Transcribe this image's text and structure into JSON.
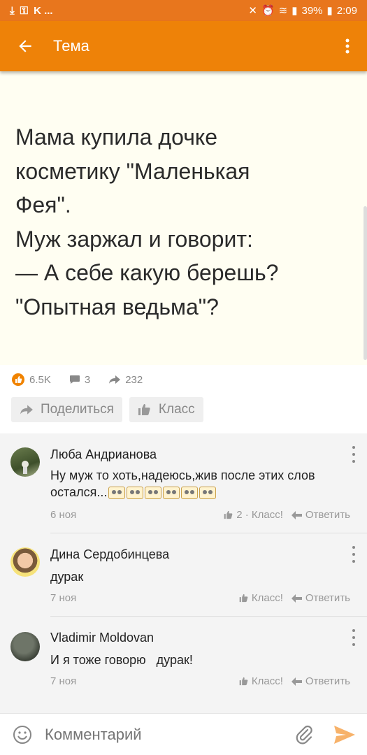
{
  "status_bar": {
    "left_text": "K ...",
    "battery": "39%",
    "time": "2:09"
  },
  "app_bar": {
    "title": "Тема",
    "icons": [
      "back-arrow-icon",
      "more-vert-icon"
    ]
  },
  "post": {
    "text": "Мама купила дочке\nкосметику \"Маленькая\nФея\".\nМуж заржал и говорит:\n— А себе какую берешь?\n\"Опытная ведьма\"?",
    "likes": "6.5K",
    "comments_count": "3",
    "shares": "232",
    "share_label": "Поделиться",
    "like_label": "Класс"
  },
  "comments": [
    {
      "author": "Люба Андрианова",
      "text": "Ну муж то хоть,надеюсь,жив после этих слов остался...",
      "date": "6 ноя",
      "likes": "2 · Класс!",
      "reply": "Ответить"
    },
    {
      "author": "Дина Сердобинцева",
      "text": "дурак",
      "date": "7 ноя",
      "likes": "Класс!",
      "reply": "Ответить"
    },
    {
      "author": "Vladimir Moldovan",
      "text": "И я тоже говорю   дурак!",
      "date": "7 ноя",
      "likes": "Класс!",
      "reply": "Ответить"
    }
  ],
  "comment_input": {
    "placeholder": "Комментарий"
  },
  "colors": {
    "accent": "#ee8208",
    "status_bar": "#e8761d",
    "post_bg": "#fffef2",
    "send": "#f7b26a"
  }
}
